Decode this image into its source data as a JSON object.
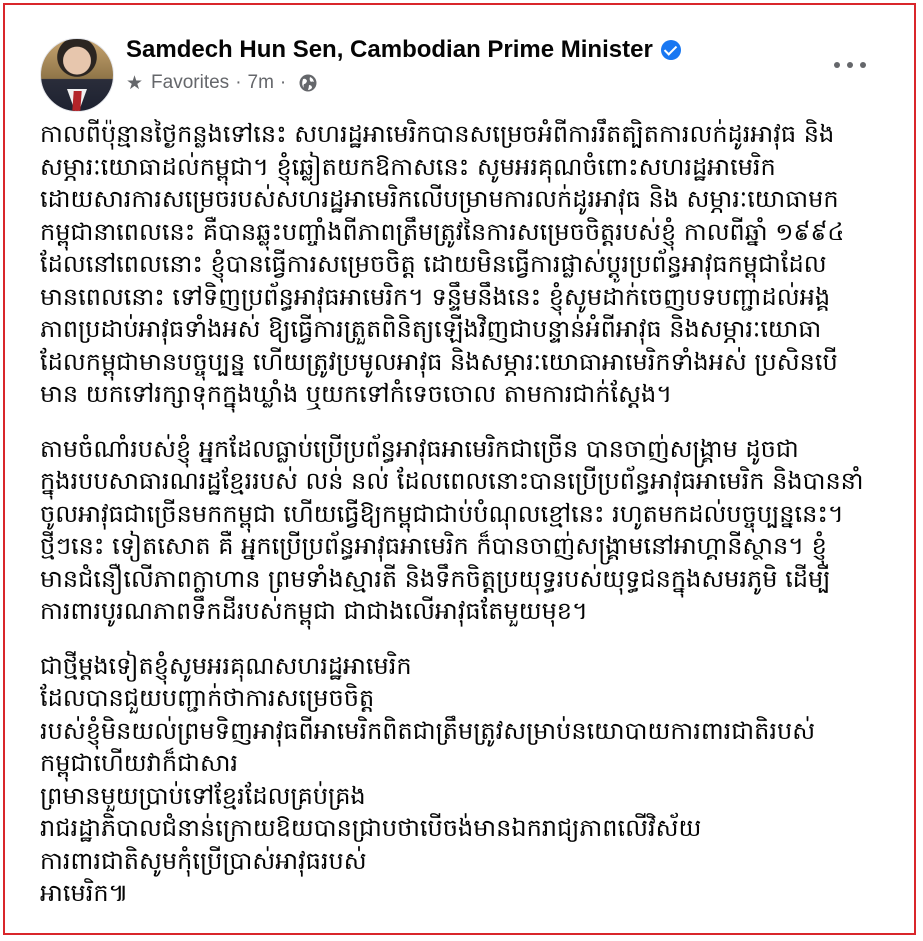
{
  "post": {
    "author_name": "Samdech Hun Sen, Cambodian Prime Minister",
    "audience_label": "Favorites",
    "separator": "·",
    "timestamp": "7m",
    "icons": {
      "star": "star-icon",
      "globe": "globe-icon",
      "verified": "verified-badge-icon",
      "more": "more-options-icon"
    },
    "colors": {
      "verified_blue": "#1877f2",
      "frame_red": "#d9262b",
      "meta_gray": "#65676b"
    },
    "paragraphs": [
      {
        "lines": [
          "កាលពីប៉ុន្មានថ្ងៃកន្លងទៅនេះ សហរដ្ឋអាមេរិកបានសម្រេចអំពីការរឹតត្បិតការលក់ដូរអាវុធ និង",
          "សម្ភារៈយោធាដល់កម្ពុជា។ ខ្ញុំឆ្លៀតយកឱកាសនេះ សូមអរគុណចំពោះសហរដ្ឋអាមេរិក",
          "ដោយសារការសម្រេចរបស់សហរដ្ឋអាមេរិកលើបម្រាមការលក់ដូរអាវុធ និង សម្ភារៈយោធាមក",
          "កម្ពុជានាពេលនេះ គឺបានឆ្លុះបញ្ចាំងពីភាពត្រឹមត្រូវនៃការសម្រេចចិត្តរបស់ខ្ញុំ កាលពីឆ្នាំ ១៩៩៤",
          "ដែលនៅពេលនោះ ខ្ញុំបានធ្វើការសម្រេចចិត្ត ដោយមិនធ្វើការផ្លាស់ប្តូរប្រព័ន្ធអាវុធកម្ពុជាដែល",
          "មានពេលនោះ ទៅទិញប្រព័ន្ធអាវុធអាមេរិក។ ទន្ទឹមនឹងនេះ ខ្ញុំសូមដាក់ចេញបទបញ្ជាដល់អង្គ",
          "ភាពប្រដាប់អាវុធទាំងអស់ ឱ្យធ្វើការត្រួតពិនិត្យឡើងវិញជាបន្ទាន់អំពីអាវុធ និងសម្ភារៈយោធា",
          "ដែលកម្ពុជាមានបច្ចុប្បន្ន ហើយត្រូវប្រមូលអាវុធ និងសម្ភារៈយោធាអាមេរិកទាំងអស់ ប្រសិនបើ",
          "មាន យកទៅរក្សាទុកក្នុងឃ្លាំង ឬយកទៅកំទេចចោល តាមការជាក់ស្តែង។"
        ]
      },
      {
        "lines": [
          "តាមចំណាំរបស់ខ្ញុំ អ្នកដែលធ្លាប់ប្រើប្រព័ន្ធអាវុធអាមេរិកជាច្រើន បានចាញ់សង្រ្គាម ដូចជា",
          "ក្នុងរបបសាធារណរដ្ឋខ្មែររបស់ លន់ នល់ ដែលពេលនោះបានប្រើប្រព័ន្ធអាវុធអាមេរិក និងបាននាំ",
          "ចូលអាវុធជាច្រើនមកកម្ពុជា ហើយធ្វើឱ្យកម្ពុជាជាប់បំណុលខ្មៅនេះ រហូតមកដល់បច្ចុប្បន្ននេះ។",
          "ថ្មីៗនេះ ទៀតសោត គឺ អ្នកប្រើប្រព័ន្ធអាវុធអាមេរិក ក៏បានចាញ់សង្រ្គាមនៅអាហ្គានីស្ថាន។ ខ្ញុំ",
          "មានជំនឿលើភាពក្លាហាន ព្រមទាំងស្មារតី និងទឹកចិត្តប្រយុទ្ធរបស់យុទ្ធជនក្នុងសមរភូមិ ដើម្បី",
          "ការពារបូរណភាពទឹកដីរបស់កម្ពុជា ជាជាងលើអាវុធតែមួយមុខ។"
        ]
      },
      {
        "lines": [
          "ជាថ្មីម្តងទៀតខ្ញុំសូមអរគុណសហរដ្ឋអាមេរិក",
          "ដែលបានជួយបញ្ជាក់ថាការសម្រេចចិត្ត",
          "របស់ខ្ញុំមិនយល់ព្រមទិញអាវុធពីអាមេរិកពិតជាត្រឹមត្រូវសម្រាប់នយោបាយការពារជាតិរបស់",
          "កម្ពុជាហើយវាក៏ជាសារ",
          "ព្រមានមួយប្រាប់ទៅខ្មែរដែលគ្រប់គ្រង",
          "រាជរដ្ឋាភិបាលជំនាន់ក្រោយឱយបានជ្រាបថាបើចង់មានឯករាជ្យភាពលើវិស័យ",
          "ការពារជាតិសូមកុំប្រើប្រាស់អាវុធរបស់",
          "អាមេរិក៕"
        ]
      }
    ]
  }
}
